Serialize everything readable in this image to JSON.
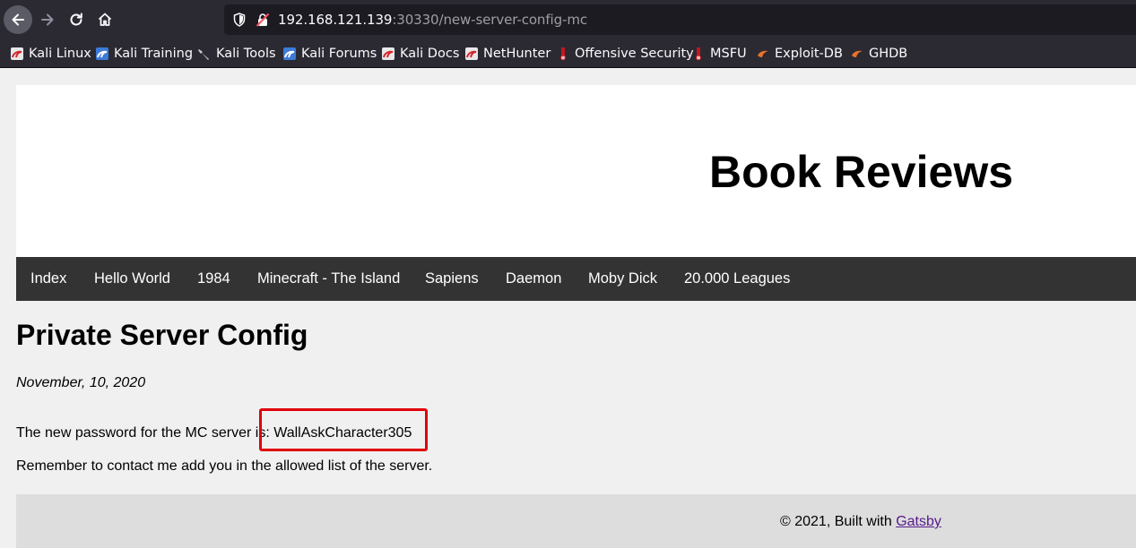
{
  "browser": {
    "url_host": "192.168.121.139",
    "url_rest": ":30330/new-server-config-mc",
    "bookmarks": [
      {
        "label": "Kali Linux",
        "icon": "kali-dragon-icon"
      },
      {
        "label": "Kali Training",
        "icon": "kali-training-icon"
      },
      {
        "label": "Kali Tools",
        "icon": "kali-tools-icon"
      },
      {
        "label": "Kali Forums",
        "icon": "kali-forums-icon"
      },
      {
        "label": "Kali Docs",
        "icon": "kali-dragon-icon"
      },
      {
        "label": "NetHunter",
        "icon": "kali-dragon-icon"
      },
      {
        "label": "Offensive Security",
        "icon": "offsec-icon"
      },
      {
        "label": "MSFU",
        "icon": "offsec-icon"
      },
      {
        "label": "Exploit-DB",
        "icon": "exploit-db-icon"
      },
      {
        "label": "GHDB",
        "icon": "exploit-db-icon"
      }
    ]
  },
  "site": {
    "title": "Book Reviews",
    "nav": [
      "Index",
      "Hello World",
      "1984",
      "Minecraft - The Island",
      "Sapiens",
      "Daemon",
      "Moby Dick",
      "20.000 Leagues"
    ]
  },
  "post": {
    "title": "Private Server Config",
    "date": "November, 10, 2020",
    "password_line": "The new password for the MC server is: WallAskCharacter305",
    "reminder_line": "Remember to contact me add you in the allowed list of the server."
  },
  "footer": {
    "text": "© 2021, Built with ",
    "link_label": "Gatsby"
  },
  "colors": {
    "browser_toolbar": "#2b2a33",
    "urlbar": "#1c1b22",
    "site_nav": "#333333",
    "highlight": "#e0000b",
    "footer_link": "#551a8b"
  }
}
